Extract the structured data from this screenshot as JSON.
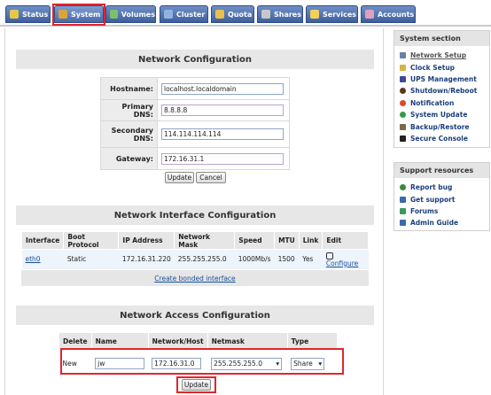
{
  "tabs": [
    {
      "label": "Status",
      "icon": "status-icon",
      "color": "#e5c84a"
    },
    {
      "label": "System",
      "icon": "system-icon",
      "color": "#d9a53a"
    },
    {
      "label": "Volumes",
      "icon": "volumes-icon",
      "color": "#7fbf6a"
    },
    {
      "label": "Cluster",
      "icon": "cluster-icon",
      "color": "#8fb3e0"
    },
    {
      "label": "Quota",
      "icon": "quota-icon",
      "color": "#e8c04a"
    },
    {
      "label": "Shares",
      "icon": "shares-icon",
      "color": "#c8c8c8"
    },
    {
      "label": "Services",
      "icon": "services-icon",
      "color": "#f2d05a"
    },
    {
      "label": "Accounts",
      "icon": "accounts-icon",
      "color": "#e0a0c0"
    }
  ],
  "active_tab": "System",
  "network_config": {
    "title": "Network Configuration",
    "fields": [
      {
        "label": "Hostname:",
        "value": "localhost.localdomain"
      },
      {
        "label": "Primary DNS:",
        "value": "8.8.8.8"
      },
      {
        "label": "Secondary DNS:",
        "value": "114.114.114.114"
      },
      {
        "label": "Gateway:",
        "value": "172.16.31.1"
      }
    ],
    "update_label": "Update",
    "cancel_label": "Cancel"
  },
  "interfaces": {
    "title": "Network Interface Configuration",
    "headers": [
      "Interface",
      "Boot Protocol",
      "IP Address",
      "Network Mask",
      "Speed",
      "MTU",
      "Link",
      "Edit"
    ],
    "row": {
      "interface": "eth0",
      "boot_protocol": "Static",
      "ip": "172.16.31.220",
      "mask": "255.255.255.0",
      "speed": "1000Mb/s",
      "mtu": "1500",
      "link": "Yes",
      "edit": "Configure"
    },
    "bonded_link": "Create bonded interface"
  },
  "access": {
    "title": "Network Access Configuration",
    "headers": [
      "Delete",
      "Name",
      "Network/Host",
      "Netmask",
      "Type"
    ],
    "row": {
      "delete": "New",
      "name": "jw",
      "host": "172.16.31.0",
      "netmask": "255.255.255.0",
      "type": "Share"
    },
    "update_label": "Update"
  },
  "sidebar": {
    "system_title": "System section",
    "system_items": [
      {
        "label": "Network Setup",
        "icon": "network-icon",
        "color": "#6b7fa8"
      },
      {
        "label": "Clock Setup",
        "icon": "clock-icon",
        "color": "#d9b24a"
      },
      {
        "label": "UPS Management",
        "icon": "ups-icon",
        "color": "#3f4a9a"
      },
      {
        "label": "Shutdown/Reboot",
        "icon": "power-icon",
        "color": "#5a3a1a"
      },
      {
        "label": "Notification",
        "icon": "notification-icon",
        "color": "#d84a2a"
      },
      {
        "label": "System Update",
        "icon": "update-icon",
        "color": "#3a9a4a"
      },
      {
        "label": "Backup/Restore",
        "icon": "backup-icon",
        "color": "#7a6a4a"
      },
      {
        "label": "Secure Console",
        "icon": "console-icon",
        "color": "#222222"
      }
    ],
    "support_title": "Support resources",
    "support_items": [
      {
        "label": "Report bug",
        "icon": "bug-icon",
        "color": "#3a8a3a"
      },
      {
        "label": "Get support",
        "icon": "support-icon",
        "color": "#3a6ab0"
      },
      {
        "label": "Forums",
        "icon": "forums-icon",
        "color": "#3a9a5a"
      },
      {
        "label": "Admin Guide",
        "icon": "guide-icon",
        "color": "#3a6ab0"
      }
    ]
  }
}
